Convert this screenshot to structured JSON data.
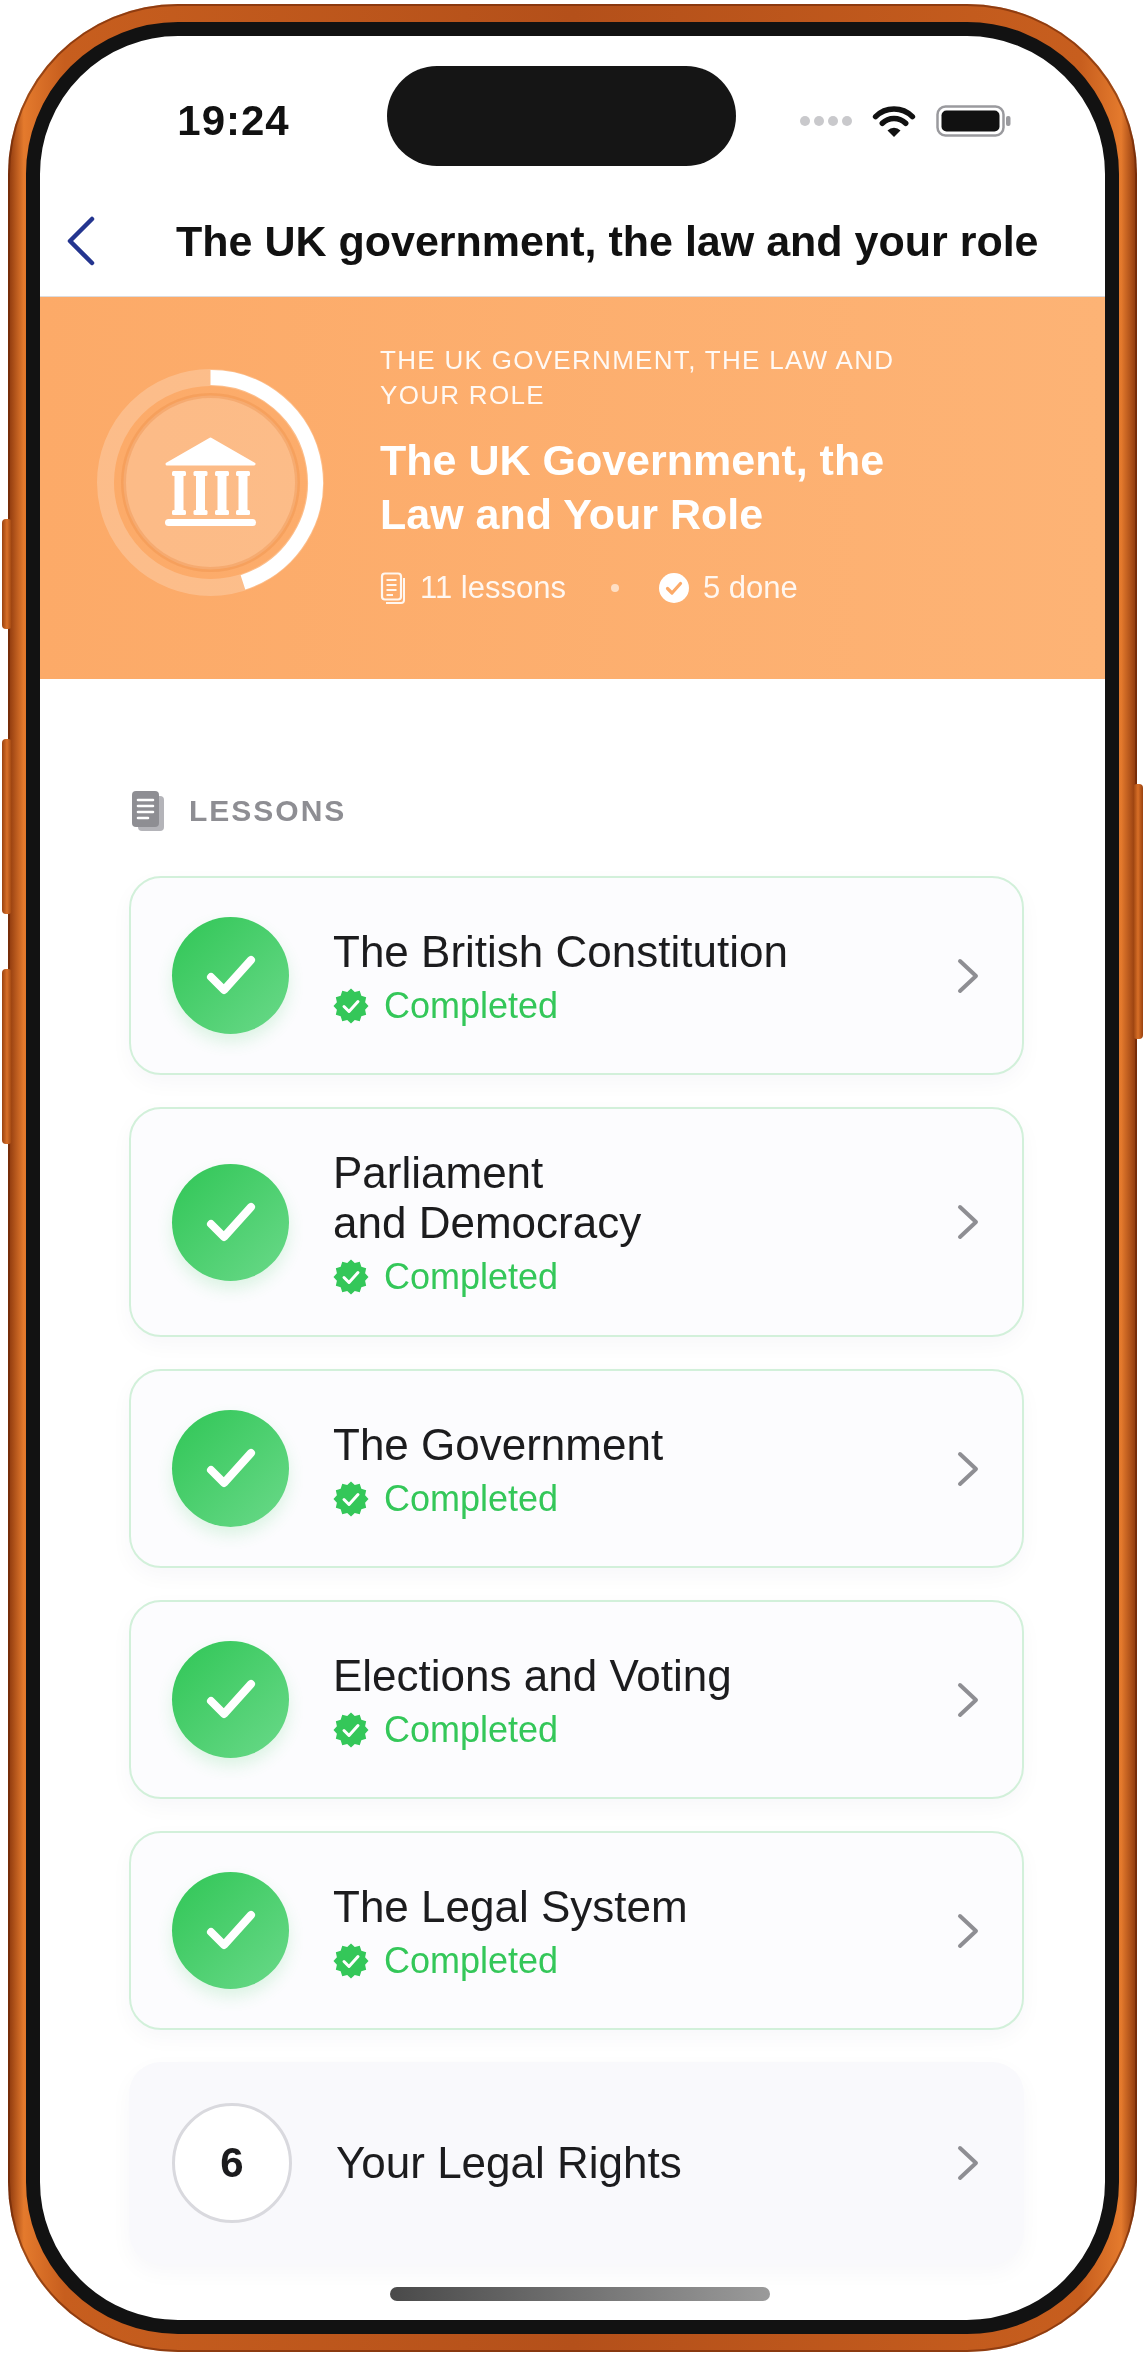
{
  "status_bar": {
    "time": "19:24"
  },
  "nav": {
    "title": "The UK government, the law and your role"
  },
  "header": {
    "eyebrow": "THE UK GOVERNMENT, THE LAW AND YOUR ROLE",
    "title": "The UK Government, the Law and Your Role",
    "progress": {
      "level": 0.45
    },
    "lessons_count": "11 lessons",
    "done_count": "5 done"
  },
  "lessons_section": {
    "heading": "LESSONS"
  },
  "lessons": [
    {
      "title": "The British Constitution",
      "completed": true,
      "status": "Completed"
    },
    {
      "title": "Parliament\nand Democracy",
      "completed": true,
      "status": "Completed"
    },
    {
      "title": "The Government",
      "completed": true,
      "status": "Completed"
    },
    {
      "title": "Elections and Voting",
      "completed": true,
      "status": "Completed"
    },
    {
      "title": "The Legal System",
      "completed": true,
      "status": "Completed"
    },
    {
      "title": "Your Legal Rights",
      "completed": false,
      "number": "6"
    }
  ]
}
